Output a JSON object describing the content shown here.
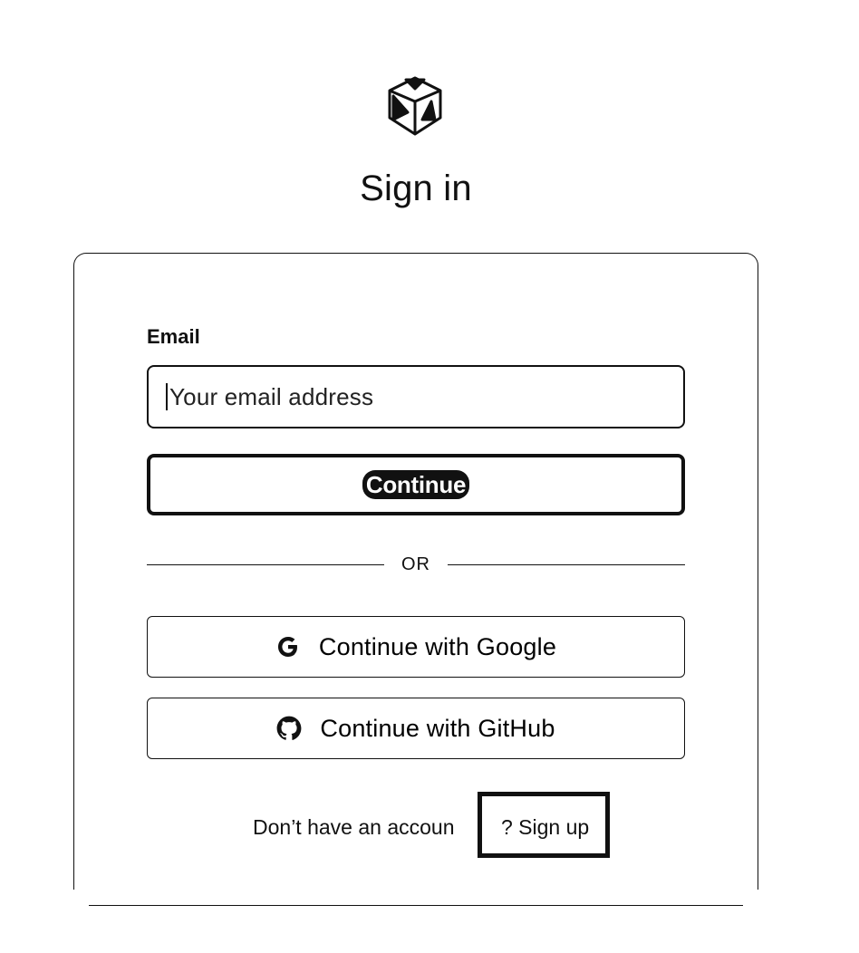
{
  "page": {
    "title": "Sign in"
  },
  "logo": {
    "icon": "app-logo-icon"
  },
  "form": {
    "email_label": "Email",
    "email_placeholder": "Your email address",
    "email_value": "",
    "continue_label": "Continue"
  },
  "divider": {
    "label": "OR"
  },
  "oauth": {
    "google_label": "Continue with Google",
    "google_icon": "google-icon",
    "github_label": "Continue with GitHub",
    "github_icon": "github-icon"
  },
  "footer": {
    "prompt": "Don’t have an accoun",
    "signup_label": "? Sign up"
  }
}
